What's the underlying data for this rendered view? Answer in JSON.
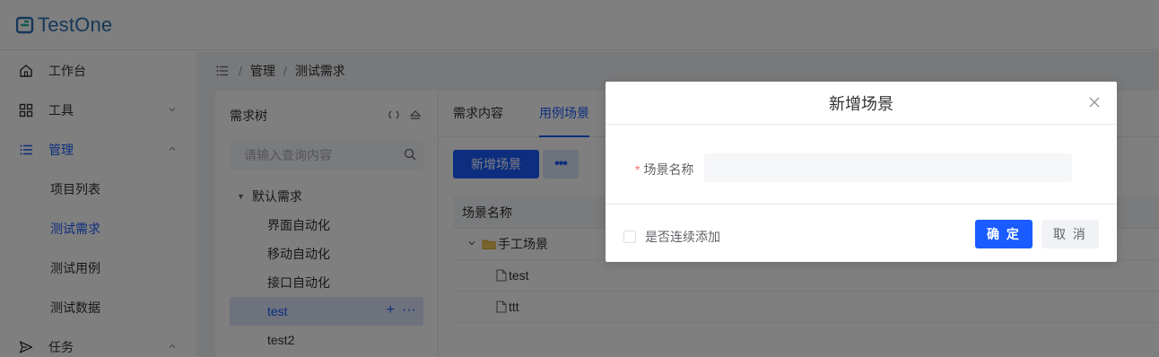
{
  "app": {
    "title": "TestOne"
  },
  "sidebar": {
    "items": [
      {
        "label": "工作台",
        "icon": "home-icon"
      },
      {
        "label": "工具",
        "icon": "grid-icon",
        "chevron": "⌄"
      },
      {
        "label": "管理",
        "icon": "list-icon",
        "chevron": "⌃"
      }
    ],
    "sub_items": [
      {
        "label": "项目列表"
      },
      {
        "label": "测试需求"
      },
      {
        "label": "测试用例"
      },
      {
        "label": "测试数据"
      }
    ],
    "last_item": {
      "label": "任务",
      "icon": "send-icon",
      "chevron": "⌃"
    }
  },
  "breadcrumb": {
    "items": [
      "管理",
      "测试需求"
    ],
    "separator": "/"
  },
  "tree": {
    "title": "需求树",
    "search_placeholder": "请输入查询内容",
    "root": "默认需求",
    "children": [
      "界面自动化",
      "移动自动化",
      "接口自动化",
      "test",
      "test2"
    ],
    "selected_actions": {
      "add": "+",
      "more": "···"
    }
  },
  "content": {
    "tabs": [
      "需求内容",
      "用例场景"
    ],
    "active_tab": "用例场景",
    "new_button": "新增场景",
    "more_button": "•••",
    "grid": {
      "header": "场景名称",
      "rows": [
        {
          "label": "手工场景",
          "type": "folder"
        },
        {
          "label": "test",
          "type": "file"
        },
        {
          "label": "ttt",
          "type": "file"
        }
      ]
    }
  },
  "modal": {
    "title": "新增场景",
    "field_label": "场景名称",
    "required_mark": "*",
    "field_value": "",
    "continuous_add_label": "是否连续添加",
    "confirm_label": "确 定",
    "cancel_label": "取 消"
  },
  "colors": {
    "primary": "#1a5cff",
    "overlay": "rgba(0,0,0,0.5)"
  }
}
